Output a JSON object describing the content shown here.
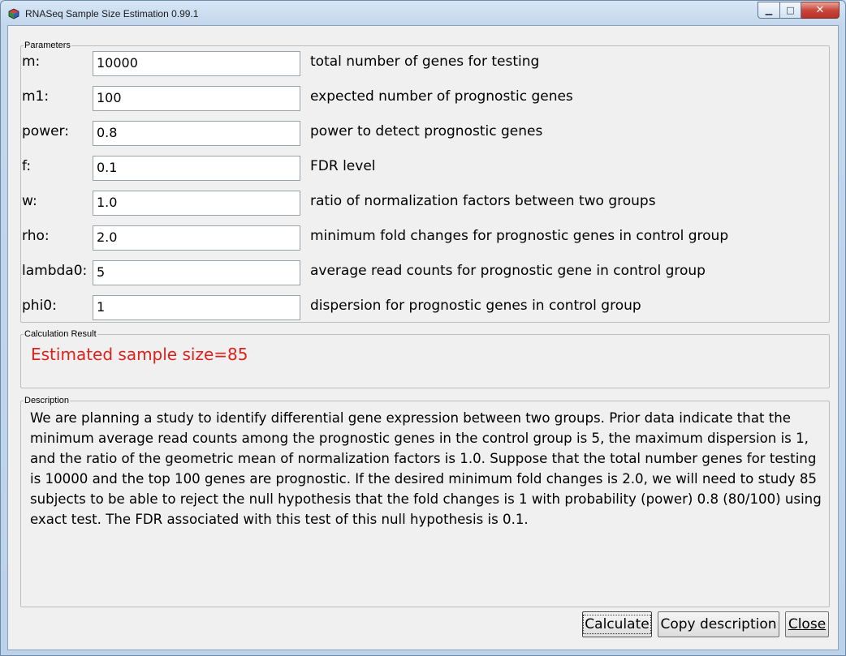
{
  "window": {
    "title": "RNASeq Sample Size Estimation 0.99.1",
    "controls": {
      "minimize": "▁",
      "maximize": "□",
      "close": "✕"
    }
  },
  "parameters": {
    "group_label": "Parameters",
    "rows": [
      {
        "label": "m:",
        "value": "10000",
        "description": "total number of genes for testing"
      },
      {
        "label": "m1:",
        "value": "100",
        "description": "expected number of prognostic genes"
      },
      {
        "label": "power:",
        "value": "0.8",
        "description": "power to detect prognostic genes"
      },
      {
        "label": "f:",
        "value": "0.1",
        "description": "FDR level"
      },
      {
        "label": "w:",
        "value": "1.0",
        "description": "ratio of normalization factors between two groups"
      },
      {
        "label": "rho:",
        "value": "2.0",
        "description": "minimum fold changes for prognostic genes in control group"
      },
      {
        "label": "lambda0:",
        "value": "5",
        "description": "average read counts for prognostic gene in control group"
      },
      {
        "label": "phi0:",
        "value": "1",
        "description": "dispersion for prognostic genes in control group"
      }
    ]
  },
  "result": {
    "group_label": "Calculation Result",
    "text": "Estimated sample size=85",
    "color": "#e0201a"
  },
  "description": {
    "group_label": "Description",
    "text": "We are planning a study to identify differential gene expression between two groups. Prior data indicate that the minimum average read counts among the prognostic genes in the control group is 5, the maximum dispersion is 1, and the ratio of the geometric mean of normalization factors is 1.0. Suppose that the total number genes for testing is 10000 and the top 100 genes are prognostic. If the desired minimum fold changes is 2.0, we will need to study 85 subjects to be able to reject the null hypothesis that the fold changes is 1 with probability (power) 0.8 (80/100) using exact test. The FDR associated with this test of this null hypothesis is 0.1."
  },
  "buttons": {
    "calculate": "Calculate",
    "copy_description": "Copy description",
    "close": "Close"
  }
}
